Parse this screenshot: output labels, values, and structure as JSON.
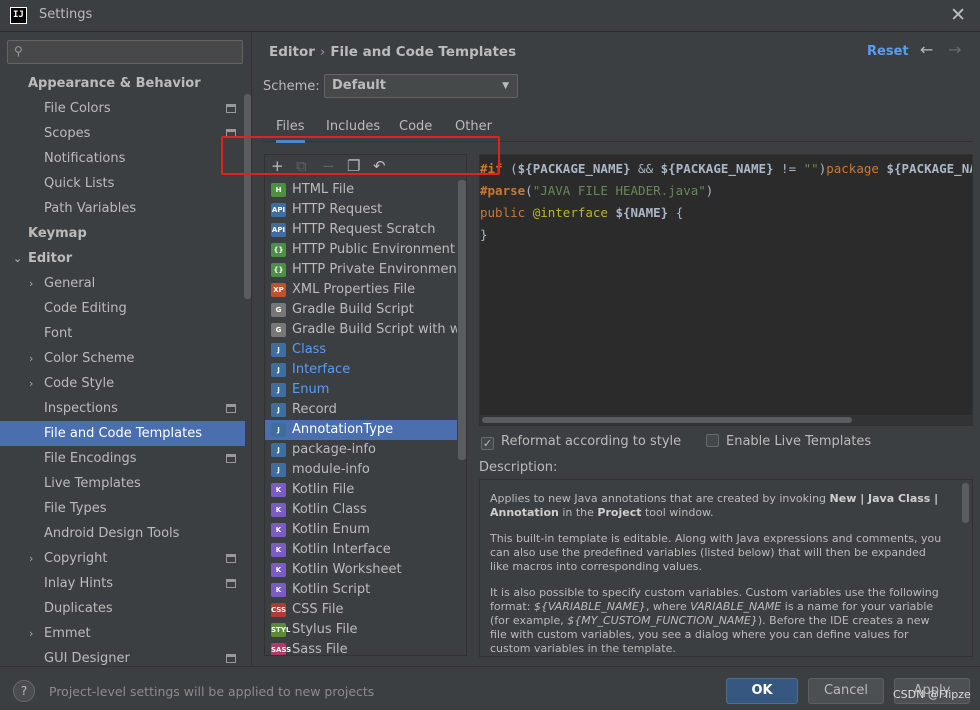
{
  "window": {
    "app_icon": "IJ",
    "title": "Settings",
    "close": "✕"
  },
  "sidebar": {
    "search_placeholder": "",
    "items": [
      {
        "label": "Appearance & Behavior",
        "bold": true,
        "indent": 28,
        "arrow": ""
      },
      {
        "label": "File Colors",
        "indent": 44,
        "project": true
      },
      {
        "label": "Scopes",
        "indent": 44,
        "project": true
      },
      {
        "label": "Notifications",
        "indent": 44
      },
      {
        "label": "Quick Lists",
        "indent": 44
      },
      {
        "label": "Path Variables",
        "indent": 44
      },
      {
        "label": "Keymap",
        "bold": true,
        "indent": 28
      },
      {
        "label": "Editor",
        "bold": true,
        "indent": 28,
        "arrow": "⌄"
      },
      {
        "label": "General",
        "indent": 44,
        "arrow": "›"
      },
      {
        "label": "Code Editing",
        "indent": 44
      },
      {
        "label": "Font",
        "indent": 44
      },
      {
        "label": "Color Scheme",
        "indent": 44,
        "arrow": "›"
      },
      {
        "label": "Code Style",
        "indent": 44,
        "arrow": "›"
      },
      {
        "label": "Inspections",
        "indent": 44,
        "project": true
      },
      {
        "label": "File and Code Templates",
        "indent": 44,
        "selected": true
      },
      {
        "label": "File Encodings",
        "indent": 44,
        "project": true
      },
      {
        "label": "Live Templates",
        "indent": 44
      },
      {
        "label": "File Types",
        "indent": 44
      },
      {
        "label": "Android Design Tools",
        "indent": 44
      },
      {
        "label": "Copyright",
        "indent": 44,
        "arrow": "›",
        "project": true
      },
      {
        "label": "Inlay Hints",
        "indent": 44,
        "project": true
      },
      {
        "label": "Duplicates",
        "indent": 44
      },
      {
        "label": "Emmet",
        "indent": 44,
        "arrow": "›"
      },
      {
        "label": "GUI Designer",
        "indent": 44,
        "project": true
      }
    ]
  },
  "header": {
    "breadcrumb_root": "Editor",
    "breadcrumb_sep": "›",
    "breadcrumb_page": "File and Code Templates",
    "reset": "Reset",
    "back": "←",
    "forward": "→"
  },
  "scheme": {
    "label": "Scheme:",
    "value": "Default"
  },
  "tabs": [
    "Files",
    "Includes",
    "Code",
    "Other"
  ],
  "toolbar": {
    "add": "+",
    "copy": "⧉",
    "remove": "−",
    "duplicate": "❐",
    "revert": "↶"
  },
  "templates": [
    {
      "label": "HTML File",
      "icon": "H",
      "color": "#4c8f45"
    },
    {
      "label": "HTTP Request",
      "icon": "API",
      "color": "#3f6e9e"
    },
    {
      "label": "HTTP Request Scratch",
      "icon": "API",
      "color": "#3f6e9e"
    },
    {
      "label": "HTTP Public Environment File",
      "icon": "{}",
      "color": "#4c8f45"
    },
    {
      "label": "HTTP Private Environment File",
      "icon": "{}",
      "color": "#4c8f45"
    },
    {
      "label": "XML Properties File",
      "icon": "XP",
      "color": "#c0522b"
    },
    {
      "label": "Gradle Build Script",
      "icon": "G",
      "color": "#777777"
    },
    {
      "label": "Gradle Build Script with wrapper",
      "icon": "G",
      "color": "#777777"
    },
    {
      "label": "Class",
      "icon": "J",
      "color": "#3f6e9e",
      "java": true
    },
    {
      "label": "Interface",
      "icon": "J",
      "color": "#3f6e9e",
      "java": true
    },
    {
      "label": "Enum",
      "icon": "J",
      "color": "#3f6e9e",
      "java": true
    },
    {
      "label": "Record",
      "icon": "J",
      "color": "#3f6e9e"
    },
    {
      "label": "AnnotationType",
      "icon": "J",
      "color": "#3f6e9e",
      "selected": true
    },
    {
      "label": "package-info",
      "icon": "J",
      "color": "#3f6e9e"
    },
    {
      "label": "module-info",
      "icon": "J",
      "color": "#3f6e9e"
    },
    {
      "label": "Kotlin File",
      "icon": "K",
      "color": "#7b5cc5"
    },
    {
      "label": "Kotlin Class",
      "icon": "K",
      "color": "#7b5cc5"
    },
    {
      "label": "Kotlin Enum",
      "icon": "K",
      "color": "#7b5cc5"
    },
    {
      "label": "Kotlin Interface",
      "icon": "K",
      "color": "#7b5cc5"
    },
    {
      "label": "Kotlin Worksheet",
      "icon": "K",
      "color": "#7b5cc5"
    },
    {
      "label": "Kotlin Script",
      "icon": "K",
      "color": "#7b5cc5"
    },
    {
      "label": "CSS File",
      "icon": "CSS",
      "color": "#b03a3a"
    },
    {
      "label": "Stylus File",
      "icon": "STYL",
      "color": "#5d8a37"
    },
    {
      "label": "Sass File",
      "icon": "SASS",
      "color": "#b03a6a"
    }
  ],
  "editor": {
    "line1": [
      {
        "t": "#if",
        "c": "c-kw"
      },
      {
        "t": " (",
        "c": "c-plain"
      },
      {
        "t": "${PACKAGE_NAME}",
        "c": "c-var"
      },
      {
        "t": " && ",
        "c": "c-plain"
      },
      {
        "t": "${PACKAGE_NAME}",
        "c": "c-var"
      },
      {
        "t": " != ",
        "c": "c-plain"
      },
      {
        "t": "\"\"",
        "c": "c-str"
      },
      {
        "t": ")",
        "c": "c-plain"
      },
      {
        "t": "package ",
        "c": "c-dir"
      },
      {
        "t": "${PACKAGE_NAME}",
        "c": "c-var"
      }
    ],
    "line2": [
      {
        "t": "#parse",
        "c": "c-kw"
      },
      {
        "t": "(",
        "c": "c-plain"
      },
      {
        "t": "\"JAVA FILE HEADER.java\"",
        "c": "c-str"
      },
      {
        "t": ")",
        "c": "c-plain"
      }
    ],
    "line3": [
      {
        "t": "public ",
        "c": "c-dir"
      },
      {
        "t": "@interface",
        "c": "c-ann"
      },
      {
        "t": " ",
        "c": "c-plain"
      },
      {
        "t": "${NAME}",
        "c": "c-var"
      },
      {
        "t": " {",
        "c": "c-plain"
      }
    ],
    "line4": [
      {
        "t": "}",
        "c": "c-plain"
      }
    ]
  },
  "options": {
    "reformat": "Reformat according to style",
    "reformat_checked": true,
    "live_templates": "Enable Live Templates",
    "live_templates_checked": false
  },
  "description": {
    "label": "Description:",
    "paragraphs": [
      [
        {
          "t": "Applies to new Java annotations that are created by invoking "
        },
        {
          "t": "New | Java Class | Annotation",
          "b": true
        },
        {
          "t": " in the "
        },
        {
          "t": "Project",
          "b": true
        },
        {
          "t": " tool window."
        }
      ],
      [
        {
          "t": "This built-in template is editable. Along with Java expressions and comments, you can also use the predefined variables (listed below) that will then be expanded like macros into corresponding values."
        }
      ],
      [
        {
          "t": "It is also possible to specify custom variables. Custom variables use the following format: "
        },
        {
          "t": "${VARIABLE_NAME}",
          "i": true
        },
        {
          "t": ", where "
        },
        {
          "t": "VARIABLE_NAME",
          "i": true
        },
        {
          "t": " is a name for your variable (for example, "
        },
        {
          "t": "${MY_CUSTOM_FUNCTION_NAME}",
          "i": true
        },
        {
          "t": "). Before the IDE creates a new file with custom variables, you see a dialog where you can define values for custom variables in the template."
        }
      ]
    ]
  },
  "footer": {
    "help": "?",
    "note": "Project-level settings will be applied to new projects",
    "ok": "OK",
    "cancel": "Cancel",
    "apply": "Apply",
    "watermark": "CSDN @Flipze"
  }
}
